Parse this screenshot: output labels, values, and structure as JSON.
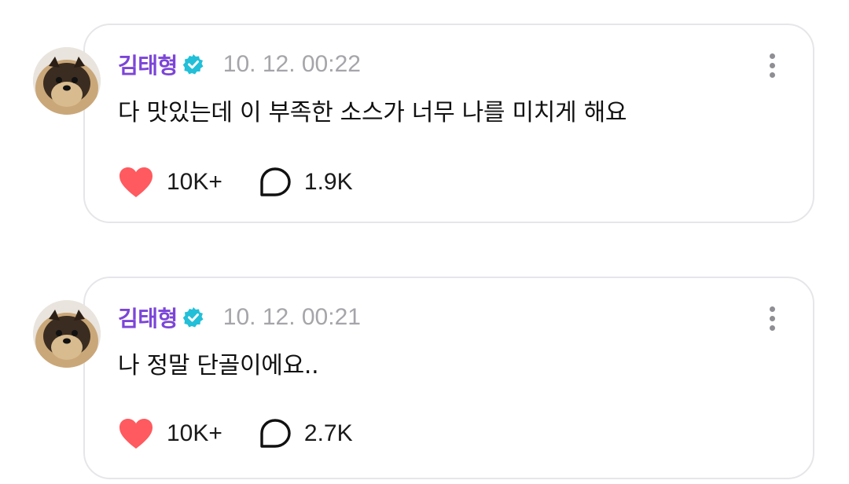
{
  "posts": [
    {
      "author": "김태형",
      "time": "10. 12. 00:22",
      "text": "다 맛있는데 이 부족한 소스가 너무 나를 미치게 해요",
      "likes": "10K+",
      "comments": "1.9K"
    },
    {
      "author": "김태형",
      "time": "10. 12. 00:21",
      "text": "나 정말 단골이에요..",
      "likes": "10K+",
      "comments": "2.7K"
    }
  ],
  "icons": {
    "verified": "verified-check-icon",
    "like": "heart-icon",
    "comment": "speech-bubble-icon",
    "more": "more-vertical-icon"
  },
  "colors": {
    "author": "#7c45d8",
    "verified": "#22bfd8",
    "heart": "#ff5a5f",
    "timestamp": "#a5a5aa",
    "border": "#e6e6ea"
  }
}
